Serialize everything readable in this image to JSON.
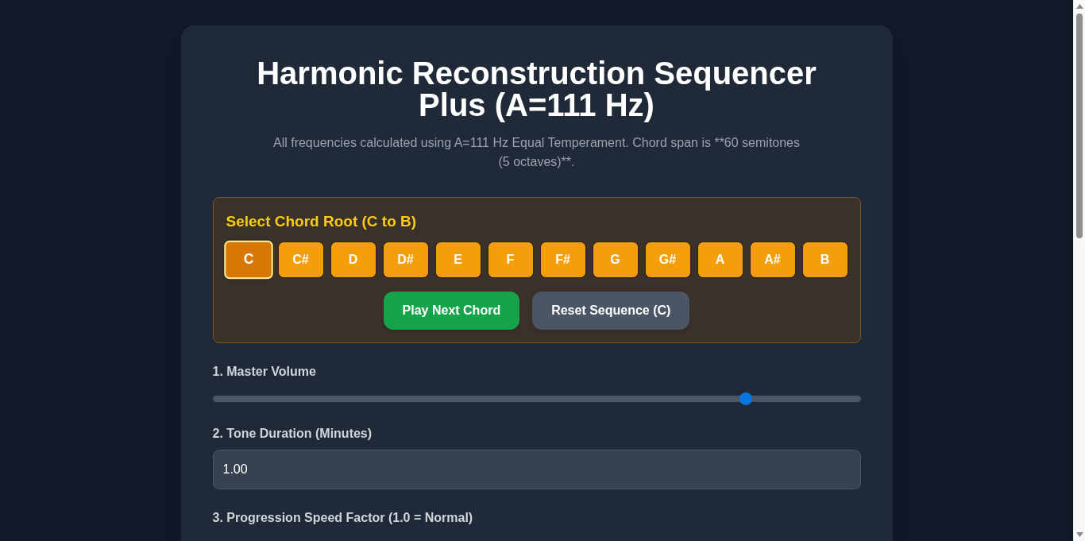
{
  "title": "Harmonic Reconstruction Sequencer Plus (A=111 Hz)",
  "subtitle": "All frequencies calculated using A=111 Hz Equal Temperament. Chord span is **60 semitones (5 octaves)**.",
  "chord_root": {
    "heading": "Select Chord Root (C to B)",
    "notes": [
      {
        "label": "C",
        "selected": true
      },
      {
        "label": "C#",
        "selected": false
      },
      {
        "label": "D",
        "selected": false
      },
      {
        "label": "D#",
        "selected": false
      },
      {
        "label": "E",
        "selected": false
      },
      {
        "label": "F",
        "selected": false
      },
      {
        "label": "F#",
        "selected": false
      },
      {
        "label": "G",
        "selected": false
      },
      {
        "label": "G#",
        "selected": false
      },
      {
        "label": "A",
        "selected": false
      },
      {
        "label": "A#",
        "selected": false
      },
      {
        "label": "B",
        "selected": false
      }
    ],
    "buttons": [
      {
        "label": "Play Next Chord",
        "kind": "primary"
      },
      {
        "label": "Reset Sequence (C)",
        "kind": "secondary"
      }
    ]
  },
  "controls": [
    {
      "kind": "slider",
      "label": "1. Master Volume",
      "level": 0.83
    },
    {
      "kind": "field",
      "label": "2. Tone Duration (Minutes)",
      "value": "1.00"
    },
    {
      "kind": "field",
      "label": "3. Progression Speed Factor (1.0 = Normal)"
    }
  ]
}
